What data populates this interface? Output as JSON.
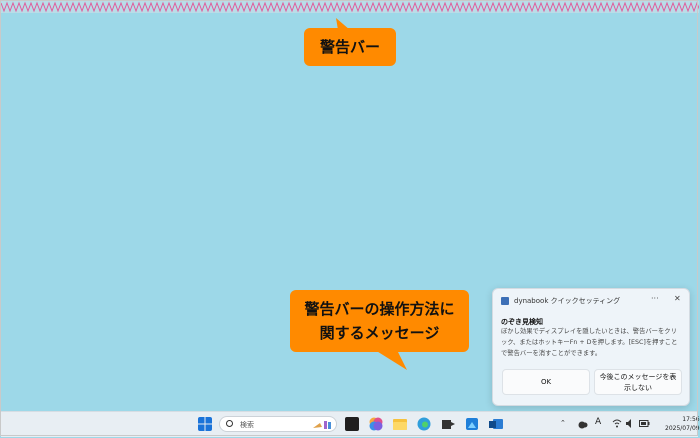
{
  "callouts": {
    "top": "警告バー",
    "bottom_line1": "警告バーの操作方法に",
    "bottom_line2": "関するメッセージ"
  },
  "notification": {
    "app": "dynabook クイックセッティング",
    "title": "のぞき見検知",
    "body": "ぼかし効果でディスプレイを隠したいときは、警告バーをクリック、またはホットキーFn + Dを押します。[ESC]を押すことで警告バーを消すことができます。",
    "ok": "OK",
    "hide_line1": "今後このメッセージを表",
    "hide_line2": "示しない"
  },
  "taskbar": {
    "search_placeholder": "検索",
    "ime": "A",
    "time": "17:56",
    "date": "2025/07/09"
  },
  "colors": {
    "callout": "#ff8a00",
    "desktop": "#9dd8e8",
    "warning_bar": "#e05a9a"
  }
}
